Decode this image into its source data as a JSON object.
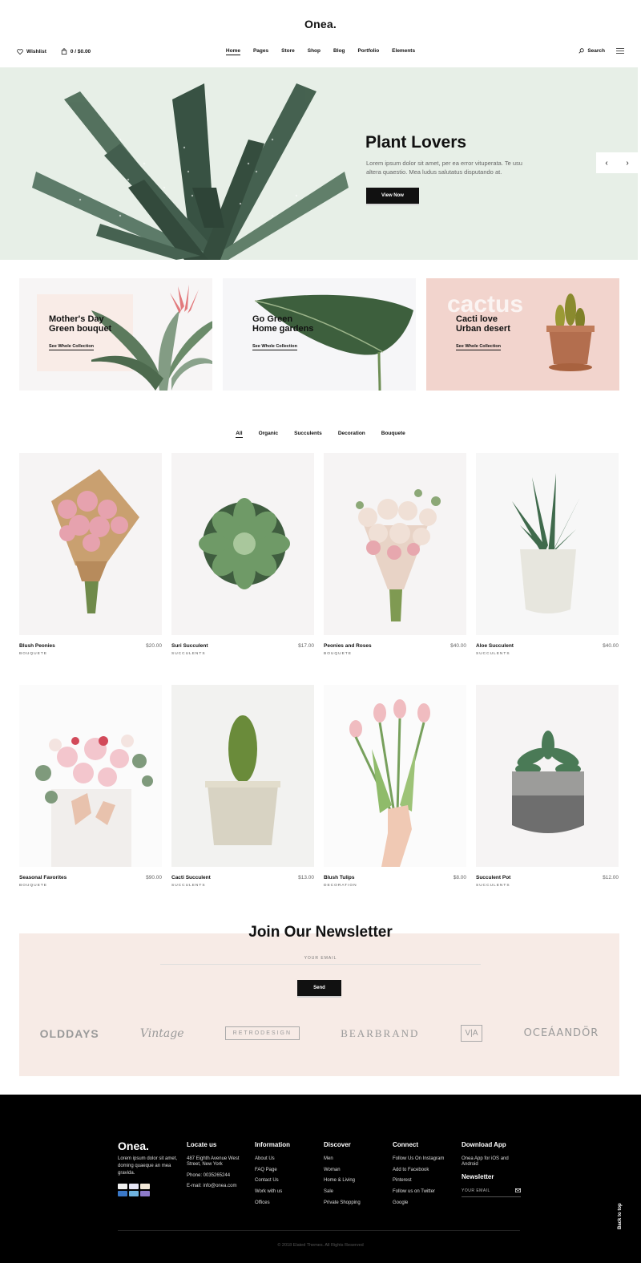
{
  "site": {
    "logo": "Onea."
  },
  "topbar": {
    "wishlist_label": "Wishlist",
    "cart_label": "0 / $0.00",
    "search_label": "Search",
    "nav": [
      "Home",
      "Pages",
      "Store",
      "Shop",
      "Blog",
      "Portfolio",
      "Elements"
    ],
    "active_nav": "Home"
  },
  "hero": {
    "title": "Plant Lovers",
    "text": "Lorem ipsum dolor sit amet, per ea error vituperata. Te usu altera quaestio. Mea ludus salutatus disputando at.",
    "button": "View Now",
    "prev_icon": "‹",
    "next_icon": "›",
    "bg_color": "#e7efe7"
  },
  "promos": [
    {
      "title": "Mother's Day\nGreen bouquet",
      "link": "See Whole Collection"
    },
    {
      "title": "Go Green\nHome gardens",
      "link": "See Whole Collection"
    },
    {
      "title": "Cacti love\nUrban desert",
      "link": "See Whole Collection",
      "ghost": "cactus"
    }
  ],
  "filters": [
    "All",
    "Organic",
    "Succulents",
    "Decoration",
    "Bouquete"
  ],
  "products": [
    {
      "name": "Blush Peonies",
      "price": "$20.00",
      "category": "BOUQUETE"
    },
    {
      "name": "Suri Succulent",
      "price": "$17.00",
      "category": "SUCCULENTS"
    },
    {
      "name": "Peonies and Roses",
      "price": "$40.00",
      "category": "BOUQUETE"
    },
    {
      "name": "Aloe Succulent",
      "price": "$40.00",
      "category": "SUCCULENTS"
    },
    {
      "name": "Seasonal Favorites",
      "price": "$90.00",
      "category": "BOUQUETE"
    },
    {
      "name": "Cacti Succulent",
      "price": "$13.00",
      "category": "SUCCULENTS"
    },
    {
      "name": "Blush Tulips",
      "price": "$8.00",
      "category": "DECORATION"
    },
    {
      "name": "Succulent Pot",
      "price": "$12.00",
      "category": "SUCCULENTS"
    }
  ],
  "newsletter": {
    "title": "Join Our Newsletter",
    "placeholder": "YOUR EMAIL",
    "button": "Send",
    "brands": [
      "OLDDAYS",
      "Vintage",
      "RETRODESIGN",
      "BEARBRAND",
      "V|A",
      "OCEÁANDÖR"
    ]
  },
  "footer": {
    "logo": "Onea.",
    "about": "Lorem ipsum dolor sit amet, doming quaeque an mea gravida.",
    "locate": {
      "title": "Locate us",
      "address": "487 Eighth Avenue West Street, New York",
      "phone": "Phone: 0035265244",
      "email": "E-mail: info@onea.com"
    },
    "information": {
      "title": "Information",
      "items": [
        "About Us",
        "FAQ Page",
        "Contact Us",
        "Work with us",
        "Offices"
      ]
    },
    "discover": {
      "title": "Discover",
      "items": [
        "Men",
        "Woman",
        "Home & Living",
        "Sale",
        "Private Shopping"
      ]
    },
    "connect": {
      "title": "Connect",
      "items": [
        "Follow Us On Instagram",
        "Add to Facebook",
        "Pinterest",
        "Follow us on Twitter",
        "Google"
      ]
    },
    "download": {
      "title": "Download App",
      "text": "Onea App for iOS and Android",
      "newsletter_title": "Newsletter",
      "email_placeholder": "YOUR EMAIL"
    },
    "copyright": "© 2018 Elated Themes. All Rights Reserved",
    "back_to_top": "Back to top"
  }
}
